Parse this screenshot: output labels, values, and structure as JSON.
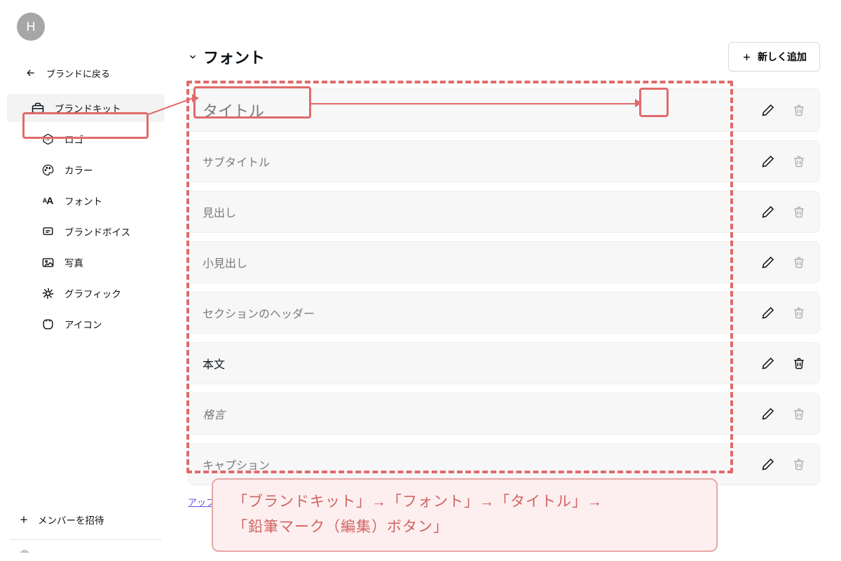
{
  "avatar_letter": "H",
  "sidebar": {
    "back": "ブランドに戻る",
    "items": [
      {
        "label": "ブランドキット",
        "icon": "briefcase"
      },
      {
        "label": "ロゴ",
        "icon": "logo"
      },
      {
        "label": "カラー",
        "icon": "palette"
      },
      {
        "label": "フォント",
        "icon": "aA"
      },
      {
        "label": "ブランドボイス",
        "icon": "voice"
      },
      {
        "label": "写真",
        "icon": "photo"
      },
      {
        "label": "グラフィック",
        "icon": "graphic"
      },
      {
        "label": "アイコン",
        "icon": "iconset"
      }
    ],
    "invite": "メンバーを招待"
  },
  "section": {
    "title": "フォント",
    "add_label": "新しく追加"
  },
  "fonts": [
    {
      "label": "タイトル",
      "style": "big",
      "trash_dim": true
    },
    {
      "label": "サブタイトル",
      "style": "",
      "trash_dim": true
    },
    {
      "label": "見出し",
      "style": "",
      "trash_dim": true
    },
    {
      "label": "小見出し",
      "style": "",
      "trash_dim": true
    },
    {
      "label": "セクションのヘッダー",
      "style": "",
      "trash_dim": true
    },
    {
      "label": "本文",
      "style": "dark",
      "trash_dim": false
    },
    {
      "label": "格言",
      "style": "italic",
      "trash_dim": true
    },
    {
      "label": "キャプション",
      "style": "",
      "trash_dim": true
    }
  ],
  "upload_link": "アップロードしたフォントの管理",
  "callout": {
    "line1": "「ブランドキット」→「フォント」→「タイトル」→",
    "line2": "「鉛筆マーク（編集）ボタン」"
  }
}
